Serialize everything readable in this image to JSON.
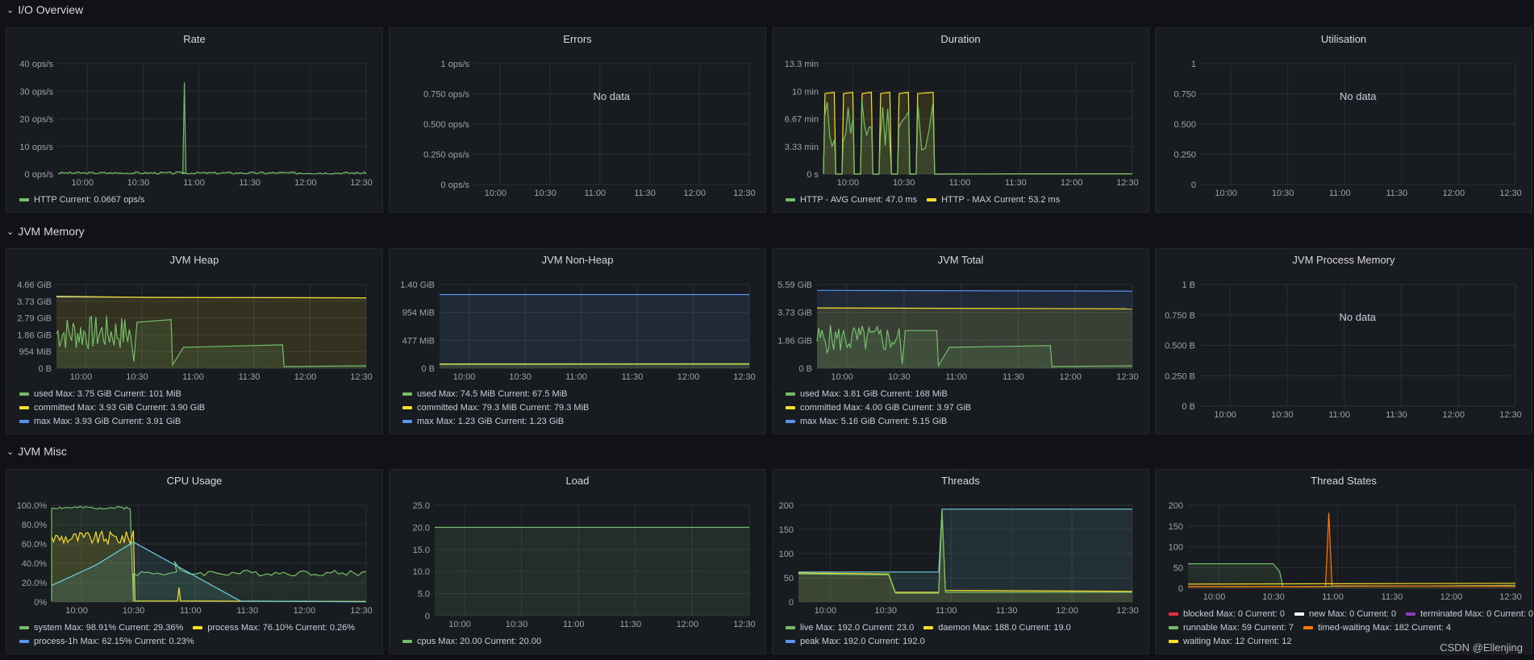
{
  "rows": [
    {
      "title": "I/O Overview"
    },
    {
      "title": "JVM Memory"
    },
    {
      "title": "JVM Misc"
    }
  ],
  "panels": [
    {
      "title": "Rate",
      "y_ticks": [
        "40 ops/s",
        "30 ops/s",
        "20 ops/s",
        "10 ops/s",
        "0 ops/s"
      ],
      "x_ticks": [
        "10:00",
        "10:30",
        "11:00",
        "11:30",
        "12:00",
        "12:30"
      ],
      "legend": [
        [
          {
            "label": "HTTP  Current: 0.0667 ops/s",
            "color": "#73bf69"
          }
        ]
      ]
    },
    {
      "title": "Errors",
      "no_data": "No data",
      "y_ticks": [
        "1 ops/s",
        "0.750 ops/s",
        "0.500 ops/s",
        "0.250 ops/s",
        "0 ops/s"
      ],
      "x_ticks": [
        "10:00",
        "10:30",
        "11:00",
        "11:30",
        "12:00",
        "12:30"
      ],
      "legend": []
    },
    {
      "title": "Duration",
      "y_ticks": [
        "13.3 min",
        "10 min",
        "6.67 min",
        "3.33 min",
        "0 s"
      ],
      "x_ticks": [
        "10:00",
        "10:30",
        "11:00",
        "11:30",
        "12:00",
        "12:30"
      ],
      "legend": [
        [
          {
            "label": "HTTP - AVG  Current: 47.0 ms",
            "color": "#73bf69"
          },
          {
            "label": "HTTP - MAX  Current: 53.2 ms",
            "color": "#fade2a"
          }
        ]
      ]
    },
    {
      "title": "Utilisation",
      "no_data": "No data",
      "y_ticks": [
        "1",
        "0.750",
        "0.500",
        "0.250",
        "0"
      ],
      "x_ticks": [
        "10:00",
        "10:30",
        "11:00",
        "11:30",
        "12:00",
        "12:30"
      ],
      "legend": []
    },
    {
      "title": "JVM Heap",
      "y_ticks": [
        "4.66 GiB",
        "3.73 GiB",
        "2.79 GiB",
        "1.86 GiB",
        "954 MiB",
        "0 B"
      ],
      "x_ticks": [
        "10:00",
        "10:30",
        "11:00",
        "11:30",
        "12:00",
        "12:30"
      ],
      "legend": [
        [
          {
            "label": "used  Max: 3.75 GiB  Current: 101 MiB",
            "color": "#73bf69"
          }
        ],
        [
          {
            "label": "committed  Max: 3.93 GiB  Current: 3.90 GiB",
            "color": "#fade2a"
          }
        ],
        [
          {
            "label": "max  Max: 3.93 GiB  Current: 3.91 GiB",
            "color": "#5794f2"
          }
        ]
      ]
    },
    {
      "title": "JVM Non-Heap",
      "y_ticks": [
        "1.40 GiB",
        "954 MiB",
        "477 MiB",
        "0 B"
      ],
      "x_ticks": [
        "10:00",
        "10:30",
        "11:00",
        "11:30",
        "12:00",
        "12:30"
      ],
      "legend": [
        [
          {
            "label": "used  Max: 74.5 MiB  Current: 67.5 MiB",
            "color": "#73bf69"
          }
        ],
        [
          {
            "label": "committed  Max: 79.3 MiB  Current: 79.3 MiB",
            "color": "#fade2a"
          }
        ],
        [
          {
            "label": "max  Max: 1.23 GiB  Current: 1.23 GiB",
            "color": "#5794f2"
          }
        ]
      ]
    },
    {
      "title": "JVM Total",
      "y_ticks": [
        "5.59 GiB",
        "3.73 GiB",
        "1.86 GiB",
        "0 B"
      ],
      "x_ticks": [
        "10:00",
        "10:30",
        "11:00",
        "11:30",
        "12:00",
        "12:30"
      ],
      "legend": [
        [
          {
            "label": "used  Max: 3.81 GiB  Current: 168 MiB",
            "color": "#73bf69"
          }
        ],
        [
          {
            "label": "committed  Max: 4.00 GiB  Current: 3.97 GiB",
            "color": "#fade2a"
          }
        ],
        [
          {
            "label": "max  Max: 5.16 GiB  Current: 5.15 GiB",
            "color": "#5794f2"
          }
        ]
      ]
    },
    {
      "title": "JVM Process Memory",
      "no_data": "No data",
      "y_ticks": [
        "1 B",
        "0.750 B",
        "0.500 B",
        "0.250 B",
        "0 B"
      ],
      "x_ticks": [
        "10:00",
        "10:30",
        "11:00",
        "11:30",
        "12:00",
        "12:30"
      ],
      "legend": []
    },
    {
      "title": "CPU Usage",
      "y_ticks": [
        "100.0%",
        "80.0%",
        "60.0%",
        "40.0%",
        "20.0%",
        "0%"
      ],
      "x_ticks": [
        "10:00",
        "10:30",
        "11:00",
        "11:30",
        "12:00",
        "12:30"
      ],
      "legend": [
        [
          {
            "label": "system  Max: 98.91%  Current: 29.36%",
            "color": "#73bf69"
          },
          {
            "label": "process  Max: 76.10%  Current: 0.26%",
            "color": "#fade2a"
          }
        ],
        [
          {
            "label": "process-1h  Max: 62.15%  Current: 0.23%",
            "color": "#5794f2"
          }
        ]
      ]
    },
    {
      "title": "Load",
      "y_ticks": [
        "25.0",
        "20.0",
        "15.0",
        "10.0",
        "5.0",
        "0"
      ],
      "x_ticks": [
        "10:00",
        "10:30",
        "11:00",
        "11:30",
        "12:00",
        "12:30"
      ],
      "legend": [
        [
          {
            "label": "cpus  Max: 20.00  Current: 20.00",
            "color": "#73bf69"
          }
        ]
      ]
    },
    {
      "title": "Threads",
      "y_ticks": [
        "200",
        "150",
        "100",
        "50",
        "0"
      ],
      "x_ticks": [
        "10:00",
        "10:30",
        "11:00",
        "11:30",
        "12:00",
        "12:30"
      ],
      "legend": [
        [
          {
            "label": "live  Max: 192.0  Current: 23.0",
            "color": "#73bf69"
          },
          {
            "label": "daemon  Max: 188.0  Current: 19.0",
            "color": "#fade2a"
          }
        ],
        [
          {
            "label": "peak  Max: 192.0  Current: 192.0",
            "color": "#5794f2"
          }
        ]
      ]
    },
    {
      "title": "Thread States",
      "y_ticks": [
        "200",
        "150",
        "100",
        "50",
        "0"
      ],
      "x_ticks": [
        "10:00",
        "10:30",
        "11:00",
        "11:30",
        "12:00",
        "12:30"
      ],
      "legend": [
        [
          {
            "label": "blocked  Max: 0  Current: 0",
            "color": "#e02f44"
          },
          {
            "label": "new  Max: 0  Current: 0",
            "color": "#ffffff"
          },
          {
            "label": "terminated  Max: 0  Current: 0",
            "color": "#8f3bb8"
          }
        ],
        [
          {
            "label": "runnable  Max: 59  Current: 7",
            "color": "#73bf69"
          },
          {
            "label": "timed-waiting  Max: 182  Current: 4",
            "color": "#ff780a"
          }
        ],
        [
          {
            "label": "waiting  Max: 12  Current: 12",
            "color": "#fade2a"
          }
        ]
      ]
    }
  ],
  "watermark": "CSDN @Ellenjing"
}
